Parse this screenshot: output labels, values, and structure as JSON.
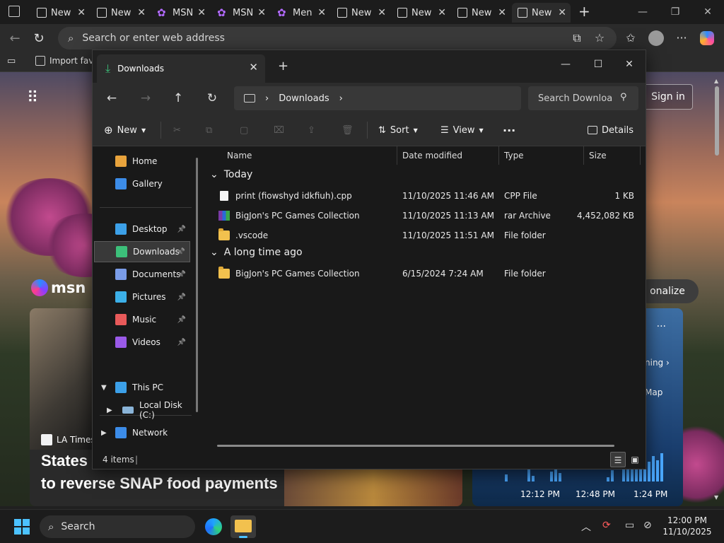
{
  "browser": {
    "tabs": [
      {
        "label": "New",
        "icon": "page-icon"
      },
      {
        "label": "New",
        "icon": "page-icon"
      },
      {
        "label": "MSN",
        "icon": "msn-icon"
      },
      {
        "label": "MSN",
        "icon": "msn-icon"
      },
      {
        "label": "Men",
        "icon": "msn-icon"
      },
      {
        "label": "New",
        "icon": "page-icon"
      },
      {
        "label": "New",
        "icon": "page-icon"
      },
      {
        "label": "New",
        "icon": "page-icon"
      },
      {
        "label": "New",
        "icon": "page-icon"
      }
    ],
    "new_tab_label": "+",
    "address_placeholder": "Search or enter web address",
    "favorites": {
      "import_label": "Import favo"
    }
  },
  "msn": {
    "signin_label": "Sign in",
    "logo_text": "msn",
    "personalize_label": "onalize",
    "news": {
      "source": "LA Times",
      "headline_line1": "States",
      "headline_line2": "to reverse SNAP food payments"
    },
    "weather": {
      "more_label": "···",
      "link_label": "ning",
      "map_label": "Map",
      "times": [
        "12:12 PM",
        "12:48 PM",
        "1:24 PM"
      ]
    }
  },
  "explorer": {
    "tab_title": "Downloads",
    "window_controls": {
      "minimize": "—",
      "maximize": "☐",
      "close": "✕"
    },
    "breadcrumb": [
      "Downloads"
    ],
    "search_placeholder": "Search Downloa",
    "commands": {
      "new_label": "New",
      "sort_label": "Sort",
      "view_label": "View",
      "more_label": "···",
      "details_label": "Details"
    },
    "sidebar": {
      "quick": [
        {
          "label": "Home",
          "icon": "home-icon",
          "color": "#e8a33c"
        },
        {
          "label": "Gallery",
          "icon": "gallery-icon",
          "color": "#3c8ce8"
        }
      ],
      "pinned": [
        {
          "label": "Desktop",
          "icon": "desktop-icon",
          "color": "#3ca0e8",
          "selected": false
        },
        {
          "label": "Downloads",
          "icon": "download-icon",
          "color": "#3cc07a",
          "selected": true
        },
        {
          "label": "Documents",
          "icon": "documents-icon",
          "color": "#7a9ce8",
          "selected": false
        },
        {
          "label": "Pictures",
          "icon": "pictures-icon",
          "color": "#3cb0e8",
          "selected": false
        },
        {
          "label": "Music",
          "icon": "music-icon",
          "color": "#e85a5a",
          "selected": false
        },
        {
          "label": "Videos",
          "icon": "videos-icon",
          "color": "#9a5ae8",
          "selected": false
        }
      ],
      "this_pc": "This PC",
      "local_disk": "Local Disk (C:)",
      "network": "Network"
    },
    "columns": {
      "name": "Name",
      "date": "Date modified",
      "type": "Type",
      "size": "Size"
    },
    "groups": [
      {
        "label": "Today",
        "files": [
          {
            "name": "print (fiowshyd idkfiuh).cpp",
            "date": "11/10/2025 11:46 AM",
            "type": "CPP File",
            "size": "1 KB",
            "kind": "cpp"
          },
          {
            "name": "BigJon's PC Games Collection",
            "date": "11/10/2025 11:13 AM",
            "type": "rar Archive",
            "size": "4,452,082 KB",
            "kind": "rar"
          },
          {
            "name": ".vscode",
            "date": "11/10/2025 11:51 AM",
            "type": "File folder",
            "size": "",
            "kind": "folder"
          }
        ]
      },
      {
        "label": "A long time ago",
        "files": [
          {
            "name": "BigJon's PC Games Collection",
            "date": "6/15/2024 7:24 AM",
            "type": "File folder",
            "size": "",
            "kind": "folder"
          }
        ]
      }
    ],
    "status": {
      "count": "4 items",
      "separator": "|"
    }
  },
  "taskbar": {
    "search_label": "Search",
    "time": "12:00 PM",
    "date": "11/10/2025"
  }
}
